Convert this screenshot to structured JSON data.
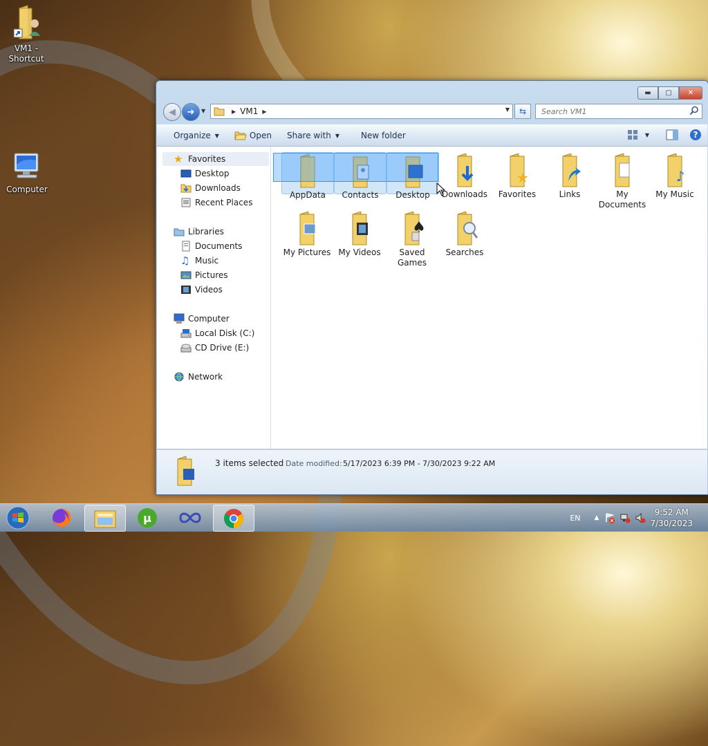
{
  "desktop": {
    "icons": [
      {
        "label": "VM1 - Shortcut",
        "icon": "user-folder-shortcut-icon"
      },
      {
        "label": "Computer",
        "icon": "computer-icon"
      }
    ]
  },
  "window": {
    "title_buttons": [
      "minimize",
      "maximize",
      "close"
    ],
    "address": {
      "path": "VM1"
    },
    "search": {
      "placeholder": "Search VM1"
    },
    "toolbar": {
      "organize": "Organize",
      "open": "Open",
      "share_with": "Share with",
      "new_folder": "New folder"
    },
    "navpane": {
      "favorites": "Favorites",
      "favorites_items": [
        "Desktop",
        "Downloads",
        "Recent Places"
      ],
      "libraries": "Libraries",
      "libraries_items": [
        "Documents",
        "Music",
        "Pictures",
        "Videos"
      ],
      "computer": "Computer",
      "computer_items": [
        "Local Disk (C:)",
        "CD Drive (E:)"
      ],
      "network": "Network"
    },
    "files": [
      {
        "name": "AppData",
        "selected": true
      },
      {
        "name": "Contacts",
        "selected": true
      },
      {
        "name": "Desktop",
        "selected": true
      },
      {
        "name": "Downloads",
        "selected": false
      },
      {
        "name": "Favorites",
        "selected": false
      },
      {
        "name": "Links",
        "selected": false
      },
      {
        "name": "My Documents",
        "selected": false
      },
      {
        "name": "My Music",
        "selected": false
      },
      {
        "name": "My Pictures",
        "selected": false
      },
      {
        "name": "My Videos",
        "selected": false
      },
      {
        "name": "Saved Games",
        "selected": false
      },
      {
        "name": "Searches",
        "selected": false
      }
    ],
    "details": {
      "selection": "3 items selected",
      "date_label": "Date modified:",
      "date_value": "5/17/2023 6:39 PM - 7/30/2023 9:22 AM"
    }
  },
  "taskbar": {
    "apps": [
      "start-orb",
      "firefox",
      "windows-explorer",
      "utorrent",
      "infinity-app",
      "chrome"
    ],
    "language": "EN",
    "time": "9:52 AM",
    "date": "7/30/2023"
  },
  "colors": {
    "selection_fill": "#cce4f7",
    "marquee": "#3399ff",
    "folder": "#f2d16b"
  }
}
